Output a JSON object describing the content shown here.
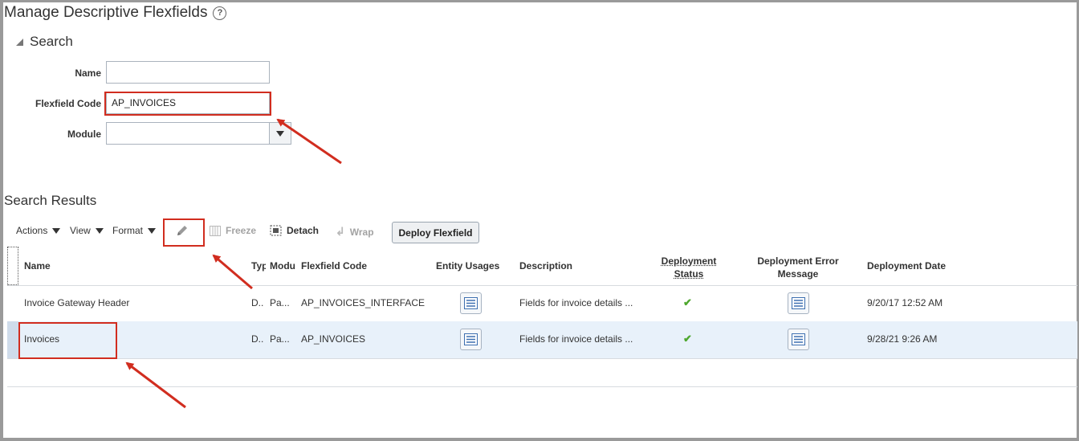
{
  "page": {
    "title": "Manage Descriptive Flexfields",
    "help_icon": "question-circle-icon"
  },
  "search": {
    "header": "Search",
    "fields": {
      "name_label": "Name",
      "name_value": "",
      "code_label": "Flexfield Code",
      "code_value": "AP_INVOICES",
      "module_label": "Module",
      "module_value": ""
    }
  },
  "results": {
    "title": "Search Results",
    "toolbar": {
      "actions": "Actions",
      "view": "View",
      "format": "Format",
      "freeze": "Freeze",
      "detach": "Detach",
      "wrap": "Wrap",
      "deploy": "Deploy Flexfield"
    },
    "columns": {
      "name": "Name",
      "type": "Typ",
      "module": "Modu",
      "code": "Flexfield Code",
      "entity": "Entity Usages",
      "desc": "Description",
      "status": "Deployment Status",
      "status_l1": "Deployment",
      "status_l2": "Status",
      "error_l1": "Deployment Error",
      "error_l2": "Message",
      "date": "Deployment Date"
    },
    "rows": [
      {
        "name": "Invoice Gateway Header",
        "type": "D..",
        "module": "Pa...",
        "code": "AP_INVOICES_INTERFACE",
        "desc": "Fields for invoice details ...",
        "status": "deployed-check-icon",
        "date": "9/20/17 12:52 AM"
      },
      {
        "name": "Invoices",
        "type": "D..",
        "module": "Pa...",
        "code": "AP_INVOICES",
        "desc": "Fields for invoice details ...",
        "status": "deployed-check-icon",
        "date": "9/28/21 9:26 AM"
      }
    ]
  },
  "annotations": {
    "callout_color": "#d12d1f"
  },
  "colors": {
    "selected_row": "#e8f1fa",
    "check_green": "#4ea72e"
  }
}
